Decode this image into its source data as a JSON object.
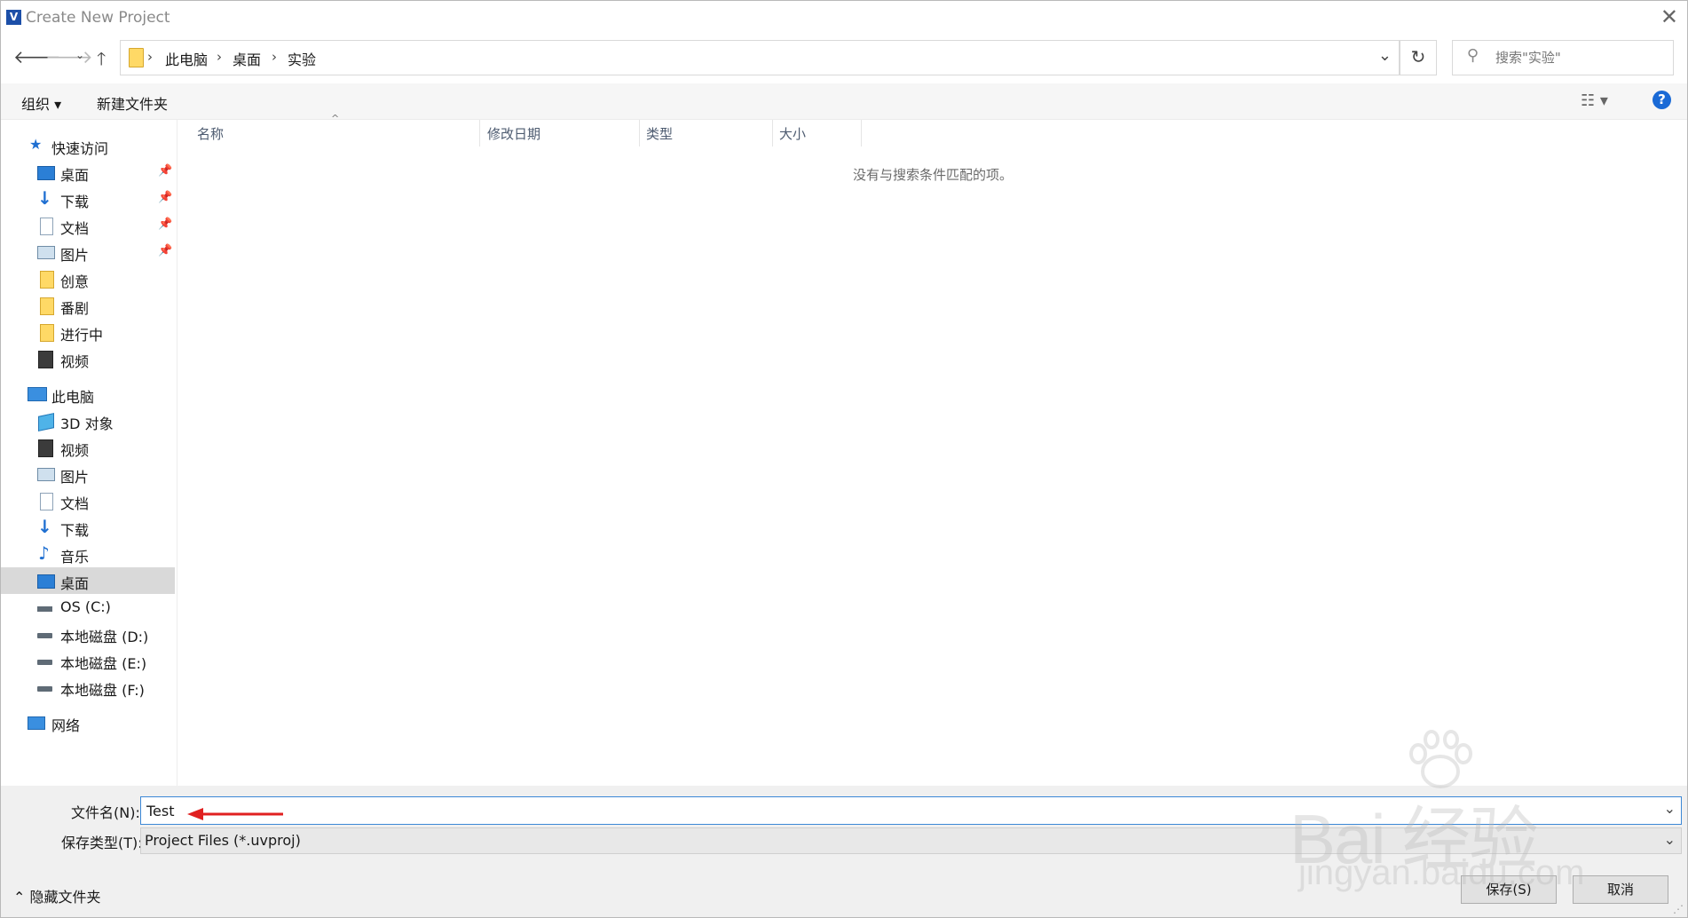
{
  "window": {
    "title": "Create New Project",
    "app_icon_glyph": "V"
  },
  "address": {
    "breadcrumbs": [
      "此电脑",
      "桌面",
      "实验"
    ],
    "search_placeholder": "搜索\"实验\""
  },
  "toolbar": {
    "organize_label": "组织 ▾",
    "new_folder_label": "新建文件夹"
  },
  "nav": {
    "quick_access": {
      "label": "快速访问",
      "items": [
        {
          "label": "桌面",
          "icon": "desktop-icon",
          "pinned": true
        },
        {
          "label": "下载",
          "icon": "download-icon",
          "pinned": true
        },
        {
          "label": "文档",
          "icon": "document-icon",
          "pinned": true
        },
        {
          "label": "图片",
          "icon": "picture-icon",
          "pinned": true
        },
        {
          "label": "创意",
          "icon": "folder-icon",
          "pinned": false
        },
        {
          "label": "番剧",
          "icon": "folder-icon",
          "pinned": false
        },
        {
          "label": "进行中",
          "icon": "folder-icon",
          "pinned": false
        },
        {
          "label": "视频",
          "icon": "video-icon",
          "pinned": false
        }
      ]
    },
    "this_pc": {
      "label": "此电脑",
      "items": [
        {
          "label": "3D 对象",
          "icon": "3d-objects-icon"
        },
        {
          "label": "视频",
          "icon": "video-icon"
        },
        {
          "label": "图片",
          "icon": "picture-icon"
        },
        {
          "label": "文档",
          "icon": "document-icon"
        },
        {
          "label": "下载",
          "icon": "download-icon"
        },
        {
          "label": "音乐",
          "icon": "music-icon"
        },
        {
          "label": "桌面",
          "icon": "desktop-icon",
          "selected": true
        },
        {
          "label": "OS (C:)",
          "icon": "os-drive-icon"
        },
        {
          "label": "本地磁盘 (D:)",
          "icon": "drive-icon"
        },
        {
          "label": "本地磁盘 (E:)",
          "icon": "drive-icon"
        },
        {
          "label": "本地磁盘 (F:)",
          "icon": "drive-icon"
        }
      ]
    },
    "network": {
      "label": "网络"
    }
  },
  "columns": [
    "名称",
    "修改日期",
    "类型",
    "大小"
  ],
  "empty_message": "没有与搜索条件匹配的项。",
  "form": {
    "filename_label": "文件名(N):",
    "filename_value": "Test",
    "filetype_label": "保存类型(T):",
    "filetype_value": "Project Files (*.uvproj)",
    "hide_folders_label": "隐藏文件夹",
    "save_label": "保存(S)",
    "cancel_label": "取消"
  },
  "watermark": {
    "main": "Bai 经验",
    "sub": "jingyan.baidu.com"
  },
  "colors": {
    "accent": "#1a6ad6",
    "annotation_arrow": "#e02020",
    "selection": "#d9d9d9"
  }
}
